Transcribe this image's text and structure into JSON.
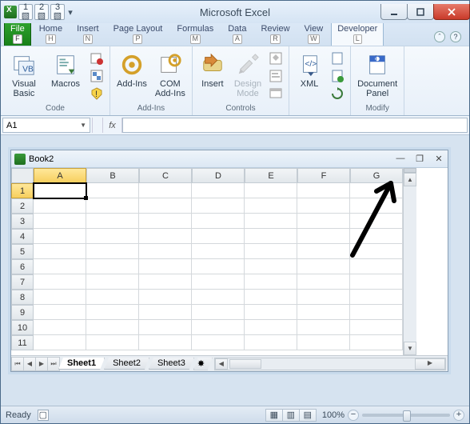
{
  "window": {
    "title": "Microsoft Excel"
  },
  "qat": {
    "step1": "1",
    "step2": "2",
    "step3": "3"
  },
  "tabs": {
    "file": {
      "label": "File",
      "key": "F"
    },
    "home": {
      "label": "Home",
      "key": "H"
    },
    "insert": {
      "label": "Insert",
      "key": "N"
    },
    "pagelayout": {
      "label": "Page Layout",
      "key": "P"
    },
    "formulas": {
      "label": "Formulas",
      "key": "M"
    },
    "data": {
      "label": "Data",
      "key": "A"
    },
    "review": {
      "label": "Review",
      "key": "R"
    },
    "view": {
      "label": "View",
      "key": "W"
    },
    "developer": {
      "label": "Developer",
      "key": "L"
    }
  },
  "ribbon": {
    "code": {
      "label": "Code",
      "visual_basic": "Visual\nBasic",
      "macros": "Macros"
    },
    "addins": {
      "label": "Add-Ins",
      "addins": "Add-Ins",
      "com": "COM\nAdd-Ins"
    },
    "controls": {
      "label": "Controls",
      "insert": "Insert",
      "design": "Design\nMode"
    },
    "xml": {
      "xml": "XML"
    },
    "modify": {
      "label": "Modify",
      "docpanel": "Document\nPanel"
    }
  },
  "namebox": {
    "value": "A1"
  },
  "fx_label": "fx",
  "workbook": {
    "title": "Book2",
    "cols": [
      "A",
      "B",
      "C",
      "D",
      "E",
      "F",
      "G"
    ],
    "rows": [
      "1",
      "2",
      "3",
      "4",
      "5",
      "6",
      "7",
      "8",
      "9",
      "10",
      "11"
    ],
    "active_cell": "A1",
    "sheets": {
      "s1": "Sheet1",
      "s2": "Sheet2",
      "s3": "Sheet3"
    }
  },
  "status": {
    "ready": "Ready",
    "zoom": "100%"
  }
}
